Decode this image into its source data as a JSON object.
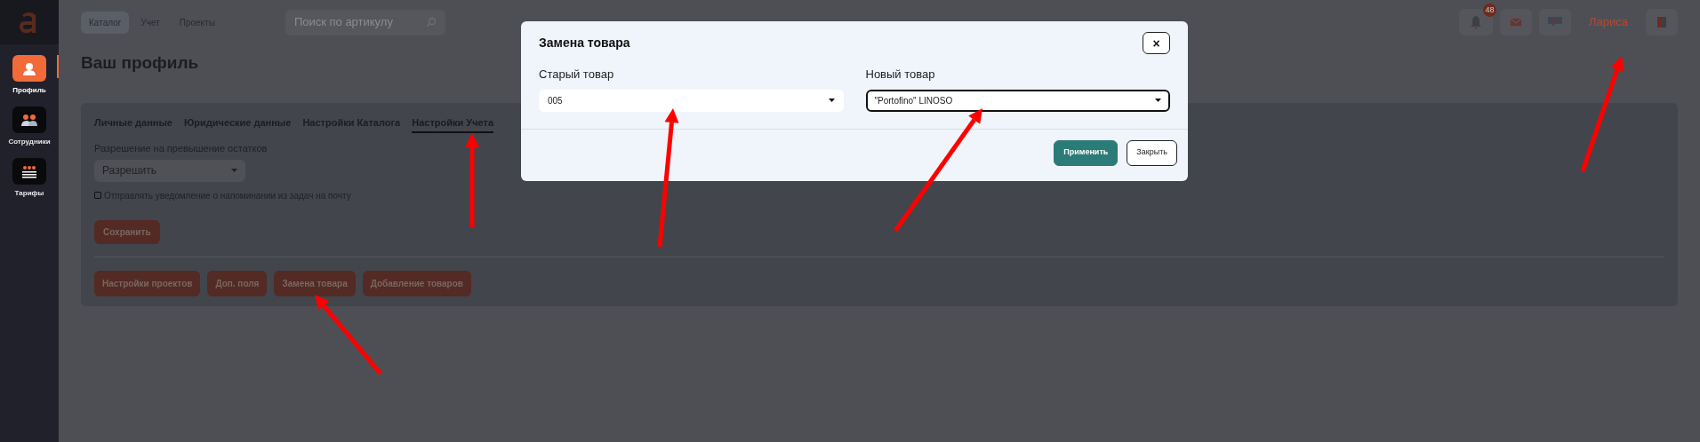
{
  "sidebar": {
    "items": [
      {
        "label": "Профиль",
        "kind": "profile",
        "selected": true
      },
      {
        "label": "Сотрудники",
        "kind": "staff",
        "selected": false
      },
      {
        "label": "Тарифы",
        "kind": "tariffs",
        "selected": false
      }
    ]
  },
  "top_nav": [
    {
      "label": "Каталог",
      "selected": true
    },
    {
      "label": "Учет",
      "selected": false
    },
    {
      "label": "Проекты",
      "selected": false
    }
  ],
  "search": {
    "placeholder": "Поиск по артикулу"
  },
  "header": {
    "notifications_badge": "48",
    "user_name": "Лариса"
  },
  "page_title": "Ваш профиль",
  "tabs": [
    {
      "label": "Личные данные",
      "selected": false
    },
    {
      "label": "Юридические данные",
      "selected": false
    },
    {
      "label": "Настройки Каталога",
      "selected": false
    },
    {
      "label": "Настройки Учета",
      "selected": true
    }
  ],
  "settings": {
    "stock_label": "Разрешение на превышение остатков",
    "stock_value": "Разрешить",
    "email_reminder": {
      "label": "Отправлять уведомление о напоминании из задач на почту",
      "checked": false
    },
    "save_button": "Сохранить"
  },
  "actions": [
    "Настройки проектов",
    "Доп. поля",
    "Замена товара",
    "Добавление товаров"
  ],
  "modal": {
    "title": "Замена товара",
    "close": "×",
    "fields": [
      {
        "label": "Старый товар",
        "value": "005",
        "focused": false
      },
      {
        "label": "Новый товар",
        "value": "\"Portofino\" LINOSO",
        "focused": true
      }
    ],
    "buttons": [
      {
        "label": "Применить",
        "kind": "primary"
      },
      {
        "label": "Закрыть",
        "kind": "secondary"
      }
    ]
  }
}
